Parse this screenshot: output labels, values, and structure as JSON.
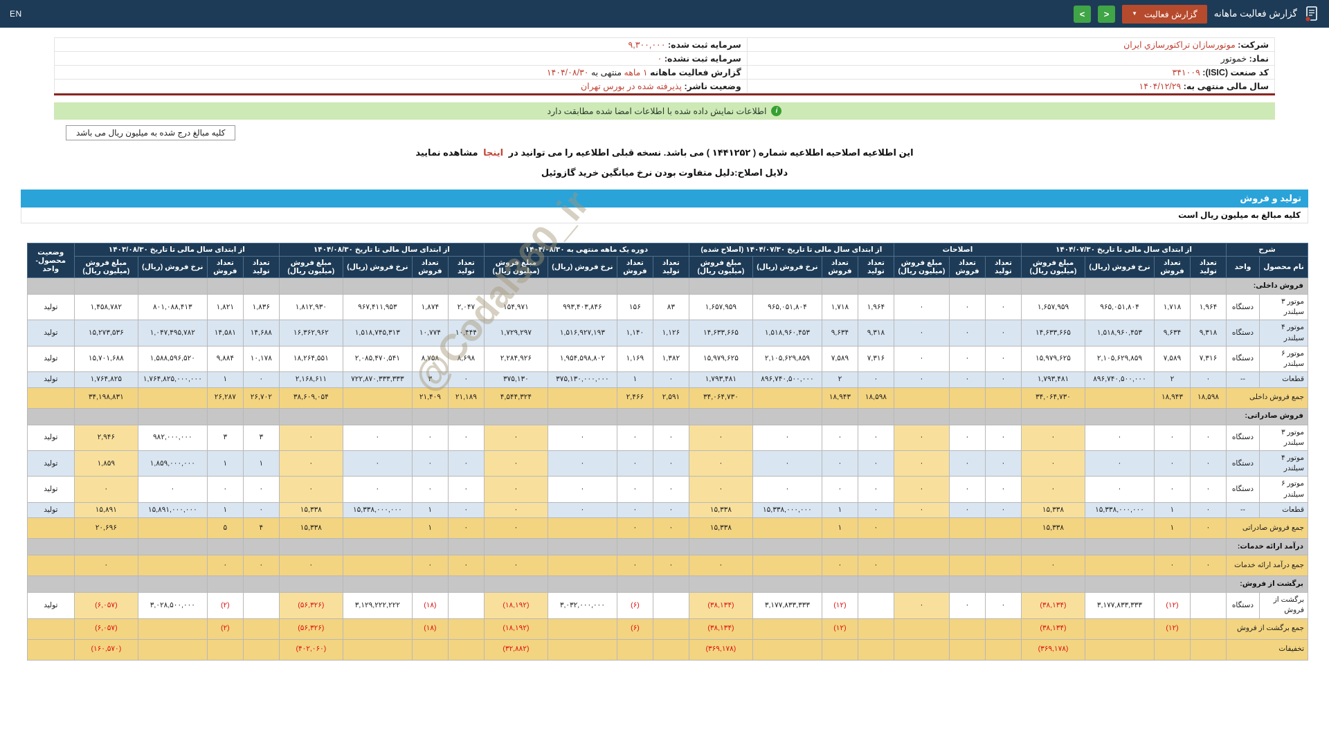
{
  "topbar": {
    "page_title": "گزارش فعالیت ماهانه",
    "dropdown_label": "گزارش فعالیت",
    "prev_label": "<",
    "next_label": ">",
    "lang": "EN"
  },
  "info": {
    "company_label": "شرکت:",
    "company": "موتورسازان تراکتورسازي ایران",
    "symbol_label": "نماد:",
    "symbol": "خموتور",
    "isic_label": "کد صنعت (ISIC):",
    "isic": "۳۴۱۰۰۹",
    "fiscal_label": "سال مالی منتهی به:",
    "fiscal": "۱۴۰۴/۱۲/۲۹",
    "cap_reg_label": "سرمایه ثبت شده:",
    "cap_reg": "۹,۳۰۰,۰۰۰",
    "cap_unreg_label": "سرمایه ثبت نشده:",
    "cap_unreg": "۰",
    "report_label": "گزارش فعالیت ماهانه",
    "report_period": "۱ ماهه",
    "report_middle": "منتهی به",
    "report_date": "۱۴۰۴/۰۸/۳۰",
    "status_label": "وضعیت ناشر:",
    "status": "پذیرفته شده در بورس تهران"
  },
  "notices": {
    "signature_match": "اطلاعات نمایش داده شده با اطلاعات امضا شده مطابقت دارد",
    "info_icon": "i",
    "amounts_note": "کلیه مبالغ درج شده به میلیون ریال می باشد",
    "amendment_pre": "این اطلاعیه اصلاحیه اطلاعیه شماره ( ۱۴۴۱۲۵۲ ) می باشد. نسخه قبلی اطلاعیه را می توانید در",
    "amendment_link": "اینجا",
    "amendment_post": "مشاهده نمایید",
    "amendment_reason": "دلایل اصلاح:دلیل متفاوت بودن نرخ میانگین خرید گازوئیل"
  },
  "section": {
    "title": "تولید و فروش",
    "amounts_unit_note": "کلیه مبالغ به میلیون ریال است"
  },
  "watermark": "@Codal360_ir",
  "table": {
    "groups": [
      {
        "label": "شرح",
        "sub": [
          "نام محصول",
          "واحد"
        ]
      },
      {
        "label": "از ابتدای سال مالی تا تاریخ ۱۴۰۴/۰۷/۳۰",
        "sub": [
          "تعداد تولید",
          "تعداد فروش",
          "نرخ فروش (ریال)",
          "مبلغ فروش (میلیون ریال)"
        ]
      },
      {
        "label": "اصلاحات",
        "sub": [
          "تعداد تولید",
          "تعداد فروش",
          "مبلغ فروش (میلیون ریال)"
        ]
      },
      {
        "label": "از ابتدای سال مالی تا تاریخ ۱۴۰۴/۰۷/۳۰ (اصلاح شده)",
        "sub": [
          "تعداد تولید",
          "تعداد فروش",
          "نرخ فروش (ریال)",
          "مبلغ فروش (میلیون ریال)"
        ]
      },
      {
        "label": "دوره یک ماهه منتهی به ۱۴۰۴/۰۸/۳۰",
        "sub": [
          "تعداد تولید",
          "تعداد فروش",
          "نرخ فروش (ریال)",
          "مبلغ فروش (میلیون ریال)"
        ]
      },
      {
        "label": "از ابتدای سال مالی تا تاریخ ۱۴۰۴/۰۸/۳۰",
        "sub": [
          "تعداد تولید",
          "تعداد فروش",
          "نرخ فروش (ریال)",
          "مبلغ فروش (میلیون ریال)"
        ]
      },
      {
        "label": "از ابتدای سال مالی تا تاریخ ۱۴۰۳/۰۸/۳۰",
        "sub": [
          "تعداد تولید",
          "تعداد فروش",
          "نرخ فروش (ریال)",
          "مبلغ فروش (میلیون ریال)"
        ]
      },
      {
        "label": "وضعیت محصول-واحد",
        "sub": []
      }
    ],
    "rows": [
      {
        "type": "section",
        "name": "فروش داخلی:"
      },
      {
        "type": "item",
        "name": "موتور ۳ سیلندر",
        "unit": "دستگاه",
        "status": "تولید",
        "cells": [
          "۱,۹۶۴",
          "۱,۷۱۸",
          "۹۶۵,۰۵۱,۸۰۴",
          "۱,۶۵۷,۹۵۹",
          "۰",
          "۰",
          "۰",
          "۱,۹۶۴",
          "۱,۷۱۸",
          "۹۶۵,۰۵۱,۸۰۴",
          "۱,۶۵۷,۹۵۹",
          "۸۳",
          "۱۵۶",
          "۹۹۳,۴۰۳,۸۴۶",
          "۱۵۴,۹۷۱",
          "۲,۰۴۷",
          "۱,۸۷۴",
          "۹۶۷,۴۱۱,۹۵۳",
          "۱,۸۱۲,۹۳۰",
          "۱,۸۳۶",
          "۱,۸۲۱",
          "۸۰۱,۰۸۸,۴۱۳",
          "۱,۴۵۸,۷۸۲"
        ]
      },
      {
        "type": "item",
        "name": "موتور ۴ سیلندر",
        "unit": "دستگاه",
        "status": "تولید",
        "cells": [
          "۹,۳۱۸",
          "۹,۶۳۴",
          "۱,۵۱۸,۹۶۰,۴۵۳",
          "۱۴,۶۳۳,۶۶۵",
          "۰",
          "۰",
          "۰",
          "۹,۳۱۸",
          "۹,۶۳۴",
          "۱,۵۱۸,۹۶۰,۴۵۳",
          "۱۴,۶۳۳,۶۶۵",
          "۱,۱۲۶",
          "۱,۱۴۰",
          "۱,۵۱۶,۹۲۷,۱۹۳",
          "۱,۷۲۹,۲۹۷",
          "۱۰,۴۴۴",
          "۱۰,۷۷۴",
          "۱,۵۱۸,۷۴۵,۳۱۳",
          "۱۶,۳۶۲,۹۶۲",
          "۱۴,۶۸۸",
          "۱۴,۵۸۱",
          "۱,۰۴۷,۴۹۵,۷۸۲",
          "۱۵,۲۷۳,۵۳۶"
        ]
      },
      {
        "type": "item",
        "name": "موتور ۶ سیلندر",
        "unit": "دستگاه",
        "status": "تولید",
        "cells": [
          "۷,۳۱۶",
          "۷,۵۸۹",
          "۲,۱۰۵,۶۲۹,۸۵۹",
          "۱۵,۹۷۹,۶۲۵",
          "۰",
          "۰",
          "۰",
          "۷,۳۱۶",
          "۷,۵۸۹",
          "۲,۱۰۵,۶۲۹,۸۵۹",
          "۱۵,۹۷۹,۶۲۵",
          "۱,۳۸۲",
          "۱,۱۶۹",
          "۱,۹۵۴,۵۹۸,۸۰۲",
          "۲,۲۸۴,۹۲۶",
          "۸,۶۹۸",
          "۸,۷۵۸",
          "۲,۰۸۵,۴۷۰,۵۴۱",
          "۱۸,۲۶۴,۵۵۱",
          "۱۰,۱۷۸",
          "۹,۸۸۴",
          "۱,۵۸۸,۵۹۶,۵۲۰",
          "۱۵,۷۰۱,۶۸۸"
        ]
      },
      {
        "type": "item",
        "name": "قطعات",
        "unit": "--",
        "status": "تولید",
        "cells": [
          "۰",
          "۲",
          "۸۹۶,۷۴۰,۵۰۰,۰۰۰",
          "۱,۷۹۳,۴۸۱",
          "۰",
          "۰",
          "۰",
          "۰",
          "۲",
          "۸۹۶,۷۴۰,۵۰۰,۰۰۰",
          "۱,۷۹۳,۴۸۱",
          "۰",
          "۱",
          "۳۷۵,۱۳۰,۰۰۰,۰۰۰",
          "۳۷۵,۱۳۰",
          "۰",
          "۳",
          "۷۲۲,۸۷۰,۳۳۳,۳۳۳",
          "۲,۱۶۸,۶۱۱",
          "۰",
          "۱",
          "۱,۷۶۴,۸۲۵,۰۰۰,۰۰۰",
          "۱,۷۶۴,۸۲۵"
        ]
      },
      {
        "type": "total",
        "name": "جمع فروش داخلی",
        "cells": [
          "۱۸,۵۹۸",
          "۱۸,۹۴۳",
          "",
          "۳۴,۰۶۴,۷۳۰",
          "",
          "",
          "",
          "۱۸,۵۹۸",
          "۱۸,۹۴۳",
          "",
          "۳۴,۰۶۴,۷۳۰",
          "۲,۵۹۱",
          "۲,۴۶۶",
          "",
          "۴,۵۴۴,۳۲۴",
          "۲۱,۱۸۹",
          "۲۱,۴۰۹",
          "",
          "۳۸,۶۰۹,۰۵۴",
          "۲۶,۷۰۲",
          "۲۶,۲۸۷",
          "",
          "۳۴,۱۹۸,۸۳۱"
        ]
      },
      {
        "type": "section",
        "name": "فروش صادراتی:"
      },
      {
        "type": "item",
        "name": "موتور ۳ سیلندر",
        "unit": "دستگاه",
        "status": "تولید",
        "hl": [
          3,
          6,
          10,
          14,
          18,
          22
        ],
        "cells": [
          "۰",
          "۰",
          "۰",
          "۰",
          "۰",
          "۰",
          "۰",
          "۰",
          "۰",
          "۰",
          "۰",
          "۰",
          "۰",
          "۰",
          "۰",
          "۰",
          "۰",
          "۰",
          "۰",
          "۳",
          "۳",
          "۹۸۲,۰۰۰,۰۰۰",
          "۲,۹۴۶"
        ]
      },
      {
        "type": "item",
        "name": "موتور ۴ سیلندر",
        "unit": "دستگاه",
        "status": "تولید",
        "hl": [
          3,
          6,
          10,
          14,
          18,
          22
        ],
        "cells": [
          "۰",
          "۰",
          "۰",
          "۰",
          "۰",
          "۰",
          "۰",
          "۰",
          "۰",
          "۰",
          "۰",
          "۰",
          "۰",
          "۰",
          "۰",
          "۰",
          "۰",
          "۰",
          "۰",
          "۱",
          "۱",
          "۱,۸۵۹,۰۰۰,۰۰۰",
          "۱,۸۵۹"
        ]
      },
      {
        "type": "item",
        "name": "موتور ۶ سیلندر",
        "unit": "دستگاه",
        "status": "تولید",
        "hl": [
          3,
          6,
          10,
          14,
          18,
          22
        ],
        "cells": [
          "۰",
          "۰",
          "۰",
          "۰",
          "۰",
          "۰",
          "۰",
          "۰",
          "۰",
          "۰",
          "۰",
          "۰",
          "۰",
          "۰",
          "۰",
          "۰",
          "۰",
          "۰",
          "۰",
          "۰",
          "۰",
          "۰",
          "۰"
        ]
      },
      {
        "type": "item",
        "name": "قطعات",
        "unit": "--",
        "status": "تولید",
        "hl": [
          3,
          6,
          10,
          14,
          18,
          22
        ],
        "cells": [
          "۰",
          "۱",
          "۱۵,۳۳۸,۰۰۰,۰۰۰",
          "۱۵,۳۳۸",
          "۰",
          "۰",
          "۰",
          "۰",
          "۱",
          "۱۵,۳۳۸,۰۰۰,۰۰۰",
          "۱۵,۳۳۸",
          "۰",
          "۰",
          "۰",
          "۰",
          "۰",
          "۱",
          "۱۵,۳۳۸,۰۰۰,۰۰۰",
          "۱۵,۳۳۸",
          "۰",
          "۱",
          "۱۵,۸۹۱,۰۰۰,۰۰۰",
          "۱۵,۸۹۱"
        ]
      },
      {
        "type": "total",
        "name": "جمع فروش صادراتی",
        "cells": [
          "۰",
          "۱",
          "",
          "۱۵,۳۳۸",
          "",
          "",
          "",
          "۰",
          "۱",
          "",
          "۱۵,۳۳۸",
          "۰",
          "۰",
          "",
          "۰",
          "۰",
          "۱",
          "",
          "۱۵,۳۳۸",
          "۴",
          "۵",
          "",
          "۲۰,۶۹۶"
        ]
      },
      {
        "type": "section",
        "name": "درآمد ارائه خدمات:"
      },
      {
        "type": "total",
        "name": "جمع درآمد ارائه خدمات",
        "cells": [
          "۰",
          "۰",
          "",
          "۰",
          "",
          "",
          "",
          "۰",
          "۰",
          "",
          "۰",
          "۰",
          "۰",
          "",
          "۰",
          "۰",
          "۰",
          "",
          "۰",
          "۰",
          "۰",
          "",
          "۰"
        ]
      },
      {
        "type": "section",
        "name": "برگشت از فروش:"
      },
      {
        "type": "item",
        "name": "برگشت از فروش",
        "unit": "دستگاه",
        "status": "تولید",
        "hl": [
          3,
          6,
          10,
          14,
          18,
          22
        ],
        "cells": [
          "",
          "(۱۲)",
          "۳,۱۷۷,۸۳۳,۳۳۳",
          "(۳۸,۱۳۴)",
          "۰",
          "۰",
          "۰",
          "",
          "(۱۲)",
          "۳,۱۷۷,۸۳۳,۳۳۳",
          "(۳۸,۱۳۴)",
          "",
          "(۶)",
          "۳,۰۳۲,۰۰۰,۰۰۰",
          "(۱۸,۱۹۲)",
          "",
          "(۱۸)",
          "۳,۱۲۹,۲۲۲,۲۲۲",
          "(۵۶,۳۲۶)",
          "",
          "(۲)",
          "۳,۰۲۸,۵۰۰,۰۰۰",
          "(۶,۰۵۷)"
        ]
      },
      {
        "type": "total",
        "name": "جمع برگشت از فروش",
        "cells": [
          "",
          "(۱۲)",
          "",
          "(۳۸,۱۳۴)",
          "",
          "",
          "",
          "",
          "(۱۲)",
          "",
          "(۳۸,۱۳۴)",
          "",
          "(۶)",
          "",
          "(۱۸,۱۹۲)",
          "",
          "(۱۸)",
          "",
          "(۵۶,۳۲۶)",
          "",
          "(۲)",
          "",
          "(۶,۰۵۷)"
        ]
      },
      {
        "type": "total",
        "name": "تخفیفات",
        "cells": [
          "",
          "",
          "",
          "(۳۶۹,۱۷۸)",
          "",
          "",
          "",
          "",
          "",
          "",
          "(۳۶۹,۱۷۸)",
          "",
          "",
          "",
          "(۳۲,۸۸۲)",
          "",
          "",
          "",
          "(۴۰۲,۰۶۰)",
          "",
          "",
          "",
          "(۱۶۰,۵۷۰)"
        ]
      }
    ]
  }
}
